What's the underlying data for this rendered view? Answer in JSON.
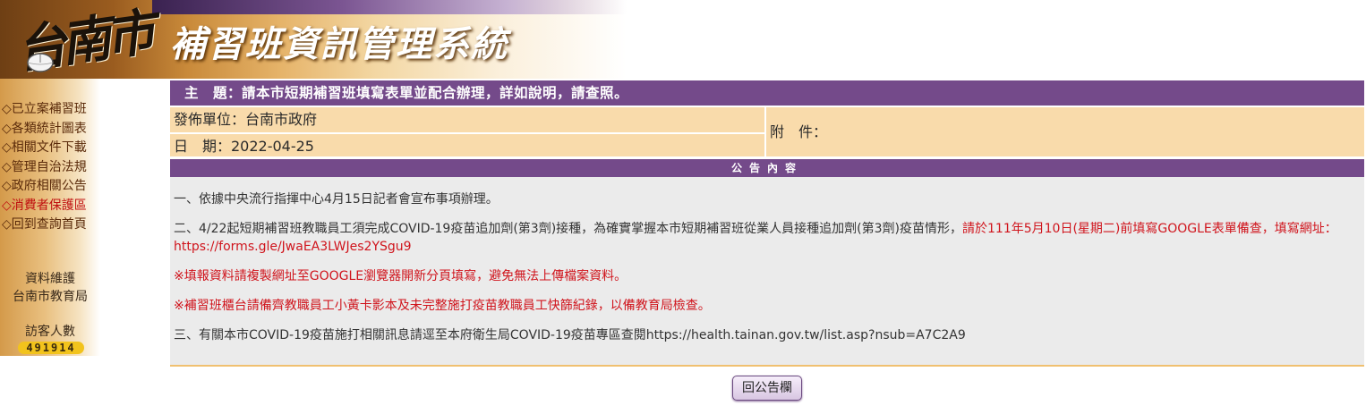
{
  "header": {
    "logo_city": "台南市",
    "system_title": "補習班資訊管理系統"
  },
  "sidebar": {
    "items": [
      {
        "label": "◇已立案補習班"
      },
      {
        "label": "◇各類統計圖表"
      },
      {
        "label": "◇相關文件下載"
      },
      {
        "label": "◇管理自治法規"
      },
      {
        "label": "◇政府相關公告"
      },
      {
        "label": "◇消費者保護區"
      },
      {
        "label": "◇回到查詢首頁"
      }
    ],
    "maintainer_label": "資料維護",
    "maintainer": "台南市教育局",
    "visitor_label": "訪客人數",
    "visitor_count": "491914"
  },
  "announcement": {
    "subject": "主　題：請本市短期補習班填寫表單並配合辦理，詳如說明，請查照。",
    "publisher": "發佈單位：台南市政府",
    "date": "日　期：2022-04-25",
    "attachment": "附　件：",
    "content_header": "公告內容",
    "paragraphs": {
      "p1": "一、依據中央流行指揮中心4月15日記者會宣布事項辦理。",
      "p2_black": "二、4/22起短期補習班教職員工須完成COVID-19疫苗追加劑(第3劑)接種，為確實掌握本市短期補習班從業人員接種追加劑(第3劑)疫苗情形，",
      "p2_red": "請於111年5月10日(星期二)前填寫GOOGLE表單備查，填寫網址：https://forms.gle/JwaEA3LWJes2YSgu9",
      "p3": "※填報資料請複製網址至GOOGLE瀏覽器開新分頁填寫，避免無法上傳檔案資料。",
      "p4": "※補習班櫃台請備齊教職員工小黃卡影本及未完整施打疫苗教職員工快篩紀錄，以備教育局檢查。",
      "p5": "三、有關本市COVID-19疫苗施打相關訊息請逕至本府衛生局COVID-19疫苗專區查閱https://health.tainan.gov.tw/list.asp?nsub=A7C2A9"
    }
  },
  "back_button": "回公告欄",
  "colors": {
    "purple_bar": "#744a8a",
    "meta_bg": "#f9dbab",
    "content_bg": "#ebebeb",
    "alert_red": "#d0141c"
  }
}
